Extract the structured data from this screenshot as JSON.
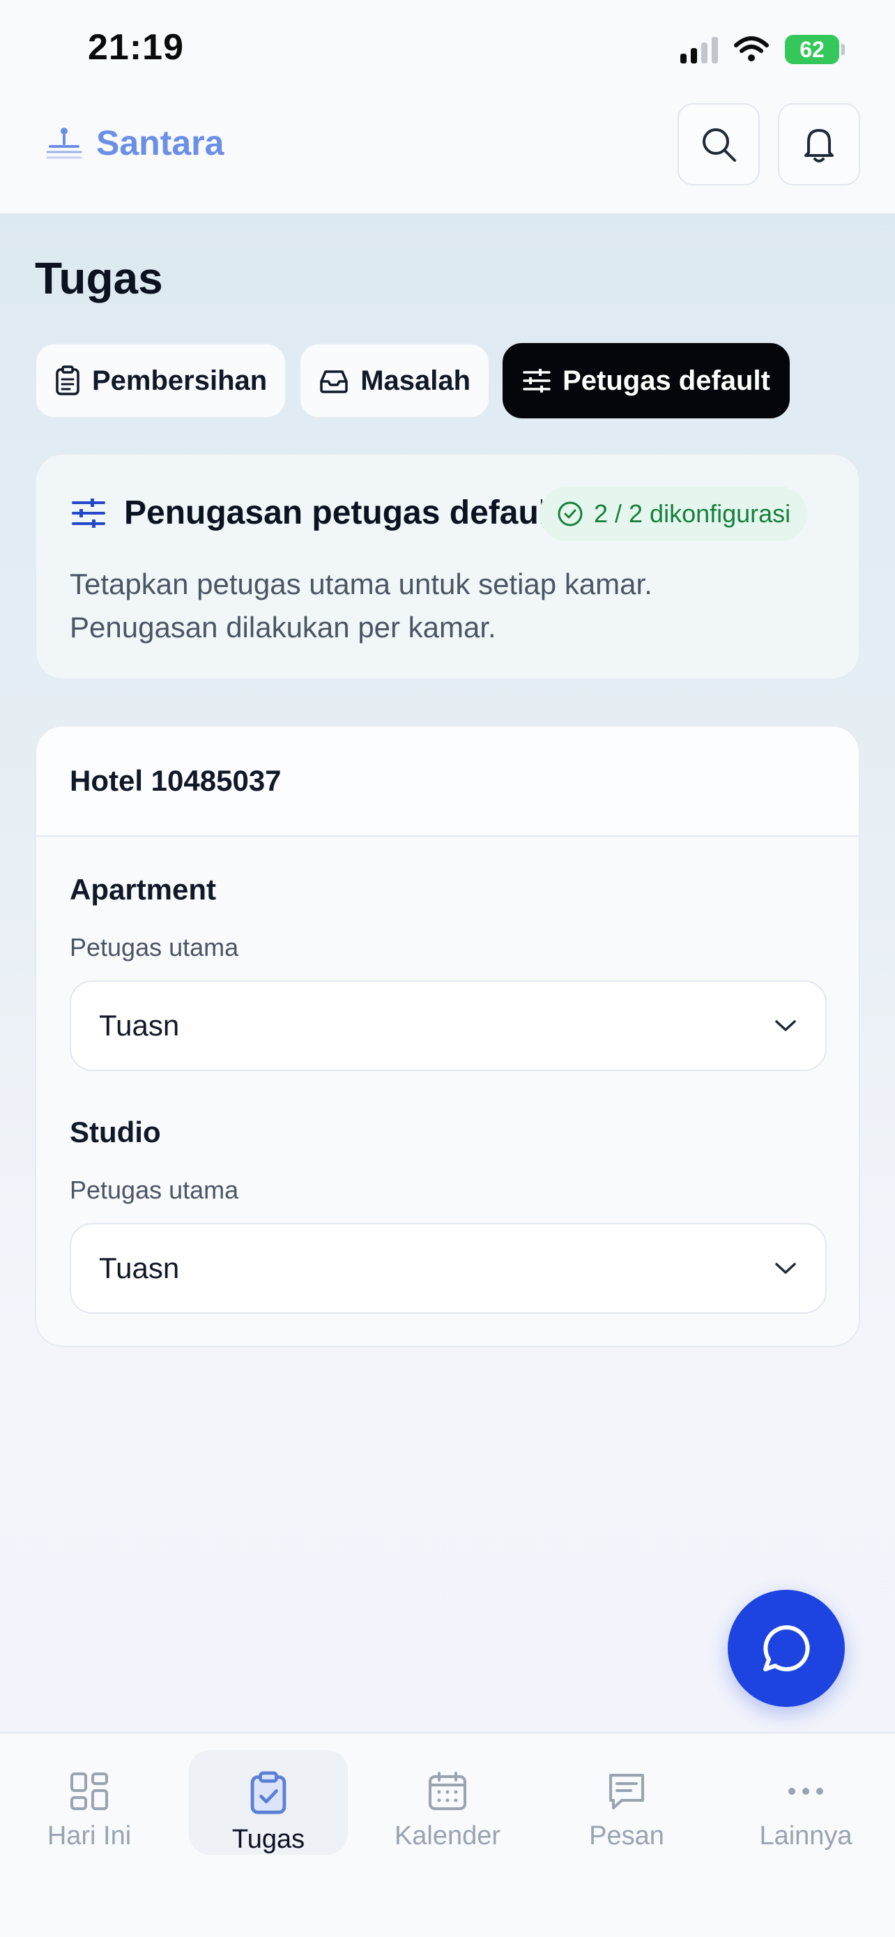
{
  "status_bar": {
    "time": "21:19",
    "battery": "62"
  },
  "header": {
    "brand": "Santara"
  },
  "page": {
    "title": "Tugas"
  },
  "tabs": [
    {
      "label": "Pembersihan",
      "icon": "clipboard-icon"
    },
    {
      "label": "Masalah",
      "icon": "inbox-icon"
    },
    {
      "label": "Petugas default",
      "icon": "sliders-icon",
      "active": true
    }
  ],
  "info_card": {
    "title": "Penugasan petugas default",
    "badge": "2 / 2 dikonfigurasi",
    "description": "Tetapkan petugas utama untuk setiap kamar. Penugasan dilakukan per kamar."
  },
  "hotel_card": {
    "title": "Hotel 10485037",
    "rooms": [
      {
        "name": "Apartment",
        "label": "Petugas utama",
        "selected": "Tuasn"
      },
      {
        "name": "Studio",
        "label": "Petugas utama",
        "selected": "Tuasn"
      }
    ]
  },
  "bottom_nav": [
    {
      "label": "Hari Ini",
      "icon": "grid-icon"
    },
    {
      "label": "Tugas",
      "icon": "clipboard-check-icon",
      "active": true
    },
    {
      "label": "Kalender",
      "icon": "calendar-icon"
    },
    {
      "label": "Pesan",
      "icon": "message-icon"
    },
    {
      "label": "Lainnya",
      "icon": "more-icon"
    }
  ],
  "colors": {
    "accent": "#1d44e0",
    "brand": "#6b8fe6",
    "success": "#15803d"
  }
}
